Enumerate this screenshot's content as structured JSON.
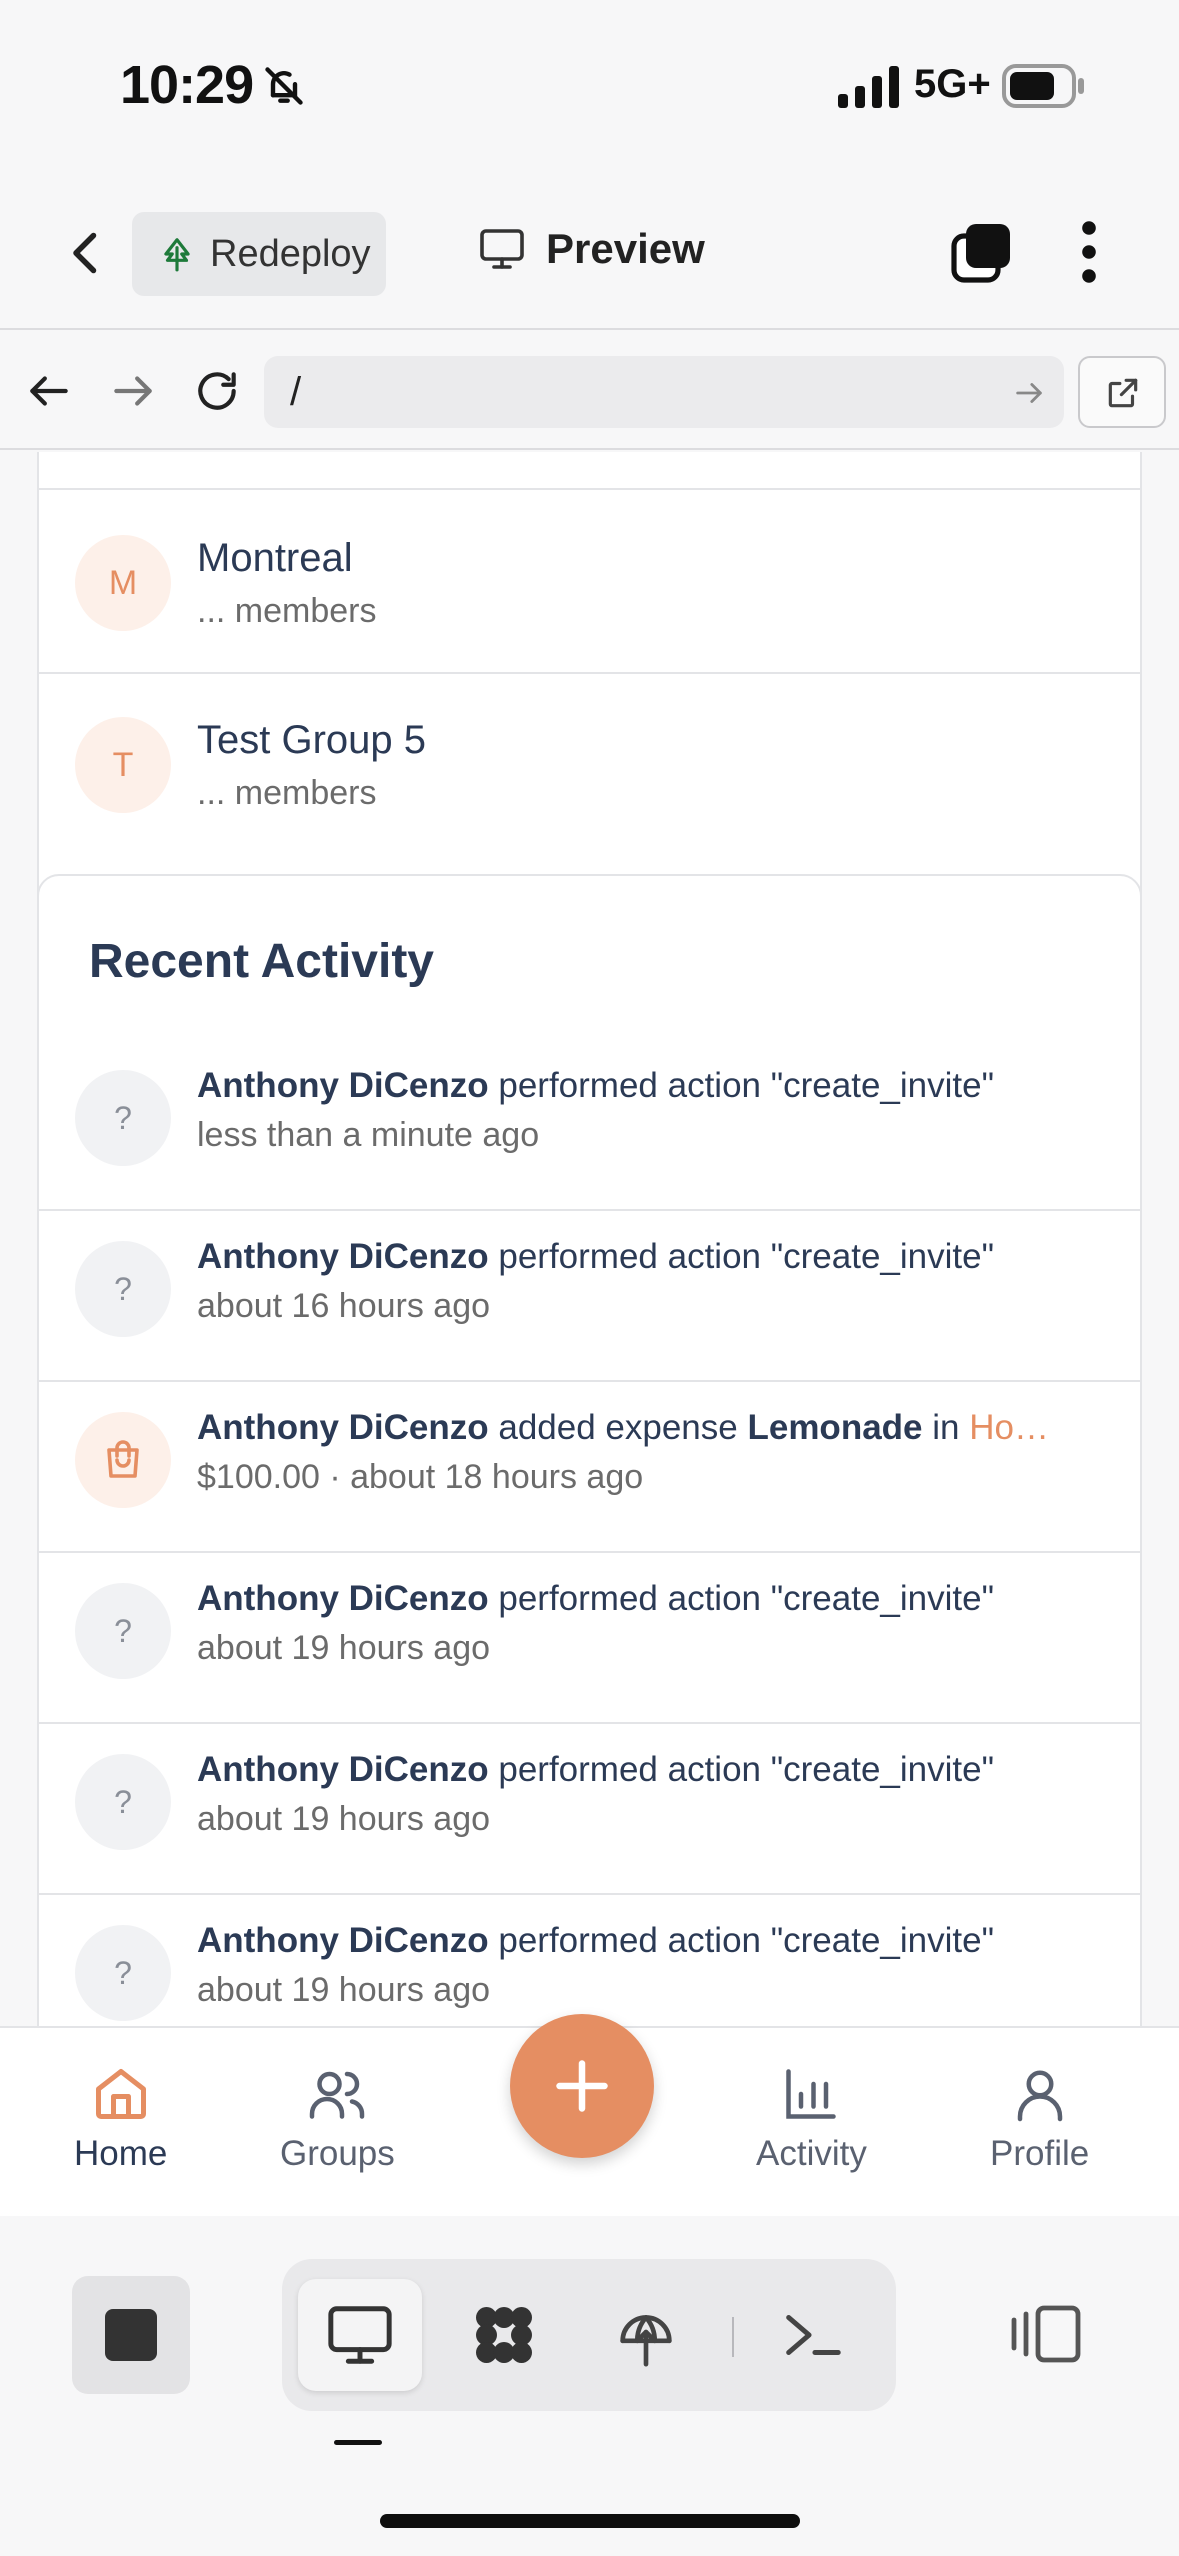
{
  "status": {
    "time": "10:29",
    "network": "5G+"
  },
  "toolbar": {
    "redeploy_label": "Redeploy",
    "preview_label": "Preview"
  },
  "browser": {
    "url": "/"
  },
  "groups": [
    {
      "initial": "M",
      "name": "Montreal",
      "members": "... members"
    },
    {
      "initial": "T",
      "name": "Test Group 5",
      "members": "... members"
    }
  ],
  "activity": {
    "title": "Recent Activity",
    "items": [
      {
        "actor": "Anthony DiCenzo",
        "text": " performed action \"create_invite\"",
        "meta": "less than a minute ago"
      },
      {
        "actor": "Anthony DiCenzo",
        "text": " performed action \"create_invite\"",
        "meta": "about 16 hours ago"
      },
      {
        "actor": "Anthony DiCenzo",
        "pre": " added expense ",
        "item": "Lemonade",
        "mid": " in ",
        "group": "Ho…",
        "meta": "$100.00 · about 18 hours ago"
      },
      {
        "actor": "Anthony DiCenzo",
        "text": " performed action \"create_invite\"",
        "meta": "about 19 hours ago"
      },
      {
        "actor": "Anthony DiCenzo",
        "text": " performed action \"create_invite\"",
        "meta": "about 19 hours ago"
      },
      {
        "actor": "Anthony DiCenzo",
        "text": " performed action \"create_invite\"",
        "meta": "about 19 hours ago"
      }
    ],
    "unknown_avatar": "?"
  },
  "nav": {
    "home": "Home",
    "groups": "Groups",
    "activity": "Activity",
    "profile": "Profile"
  },
  "colors": {
    "accent": "#e58e62",
    "heading": "#2b3a55"
  }
}
